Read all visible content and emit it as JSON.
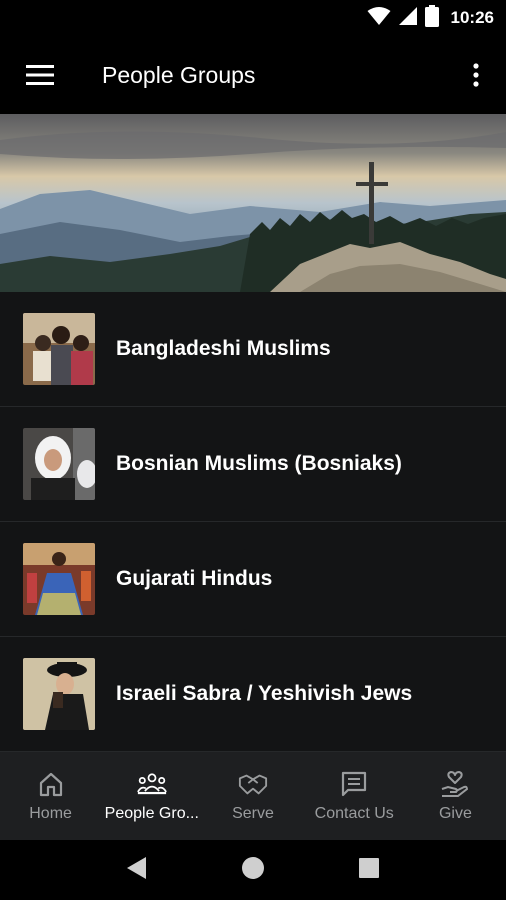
{
  "status_bar": {
    "time": "10:26",
    "icons": [
      "wifi-icon",
      "signal-icon",
      "battery-icon"
    ]
  },
  "app_bar": {
    "title": "People Groups",
    "menu_icon": "hamburger-menu-icon",
    "more_icon": "more-vert-icon"
  },
  "hero": {
    "image": "mountain-landscape-with-cross"
  },
  "people_groups": [
    {
      "label": "Bangladeshi Muslims"
    },
    {
      "label": "Bosnian Muslims (Bosniaks)"
    },
    {
      "label": "Gujarati Hindus"
    },
    {
      "label": "Israeli Sabra / Yeshivish Jews"
    }
  ],
  "bottom_nav": {
    "items": [
      {
        "label": "Home",
        "icon": "home-icon"
      },
      {
        "label": "People Gro...",
        "icon": "people-group-icon",
        "active": true
      },
      {
        "label": "Serve",
        "icon": "handshake-icon"
      },
      {
        "label": "Contact Us",
        "icon": "message-icon"
      },
      {
        "label": "Give",
        "icon": "give-hand-heart-icon"
      }
    ],
    "active_color": "#ffffff",
    "inactive_color": "#9a9c9e"
  },
  "system_nav": {
    "icons": [
      "back-icon",
      "home-circle-icon",
      "recents-icon"
    ]
  }
}
